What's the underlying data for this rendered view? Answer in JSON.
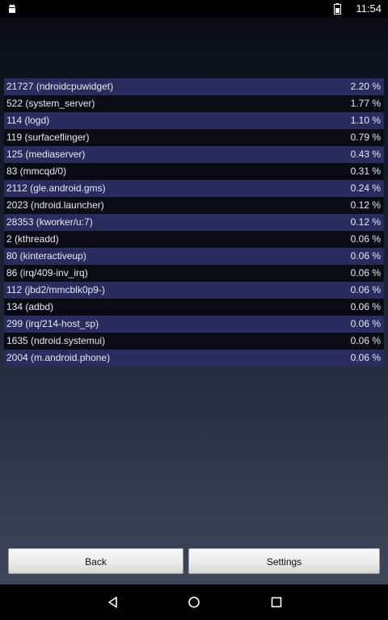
{
  "status_bar": {
    "time": "11:54",
    "icons": [
      "android-icon",
      "battery-icon"
    ]
  },
  "processes": [
    {
      "name": "21727 (ndroidcpuwidget)",
      "cpu": "2.20 %"
    },
    {
      "name": "522 (system_server)",
      "cpu": "1.77 %"
    },
    {
      "name": "114 (logd)",
      "cpu": "1.10 %"
    },
    {
      "name": "119 (surfaceflinger)",
      "cpu": "0.79 %"
    },
    {
      "name": "125 (mediaserver)",
      "cpu": "0.43 %"
    },
    {
      "name": "83 (mmcqd/0)",
      "cpu": "0.31 %"
    },
    {
      "name": "2112 (gle.android.gms)",
      "cpu": "0.24 %"
    },
    {
      "name": "2023 (ndroid.launcher)",
      "cpu": "0.12 %"
    },
    {
      "name": "28353 (kworker/u:7)",
      "cpu": "0.12 %"
    },
    {
      "name": "2 (kthreadd)",
      "cpu": "0.06 %"
    },
    {
      "name": "80 (kinteractiveup)",
      "cpu": "0.06 %"
    },
    {
      "name": "86 (irq/409-inv_irq)",
      "cpu": "0.06 %"
    },
    {
      "name": "112 (jbd2/mmcblk0p9-)",
      "cpu": "0.06 %"
    },
    {
      "name": "134 (adbd)",
      "cpu": "0.06 %"
    },
    {
      "name": "299 (irq/214-host_sp)",
      "cpu": "0.06 %"
    },
    {
      "name": "1635 (ndroid.systemui)",
      "cpu": "0.06 %"
    },
    {
      "name": "2004 (m.android.phone)",
      "cpu": "0.06 %"
    }
  ],
  "buttons": {
    "back_label": "Back",
    "settings_label": "Settings"
  },
  "nav_bar": {
    "icons": [
      "back-icon",
      "home-icon",
      "recents-icon"
    ]
  },
  "colors": {
    "row_odd": "#2b2c5e",
    "row_even": "#0b0c13",
    "text": "#e8e8f0"
  }
}
